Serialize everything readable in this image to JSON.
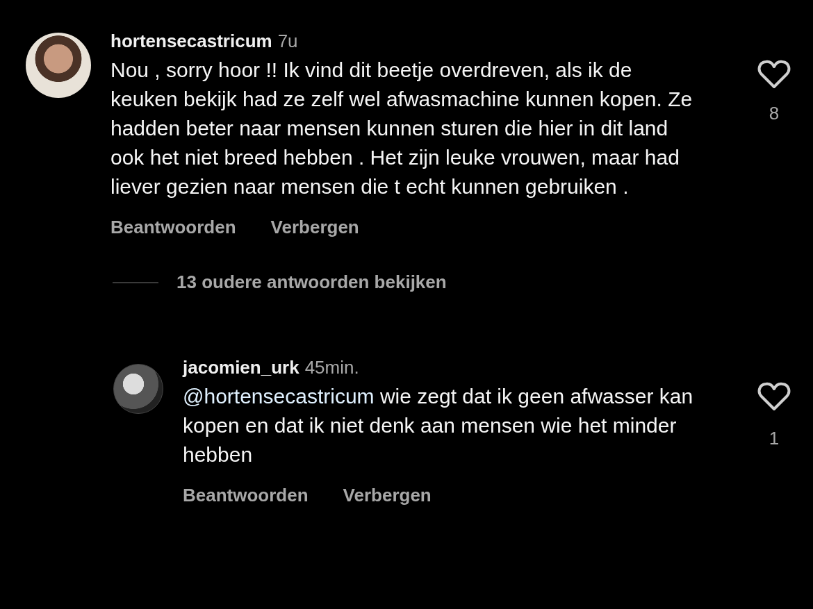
{
  "comments": [
    {
      "username": "hortensecastricum",
      "time": "7u",
      "text": "Nou , sorry hoor !! Ik vind dit beetje overdreven, als ik de keuken bekijk had ze zelf wel afwasmachine kunnen kopen. Ze hadden beter naar mensen kunnen sturen die hier in dit land ook het niet breed hebben . Het zijn leuke vrouwen, maar had liever gezien naar mensen die t echt kunnen gebruiken .",
      "likes": "8",
      "liked": false,
      "actions": [
        "Beantwoorden",
        "Verbergen"
      ]
    }
  ],
  "view_replies": "13 oudere antwoorden bekijken",
  "replies": [
    {
      "username": "jacomien_urk",
      "time": "45min.",
      "mention": "@hortensecastricum",
      "text": "wie zegt dat ik geen afwasser kan kopen en dat ik niet denk aan mensen wie het minder hebben",
      "likes": "1",
      "liked": false,
      "actions": [
        "Beantwoorden",
        "Verbergen"
      ]
    }
  ]
}
